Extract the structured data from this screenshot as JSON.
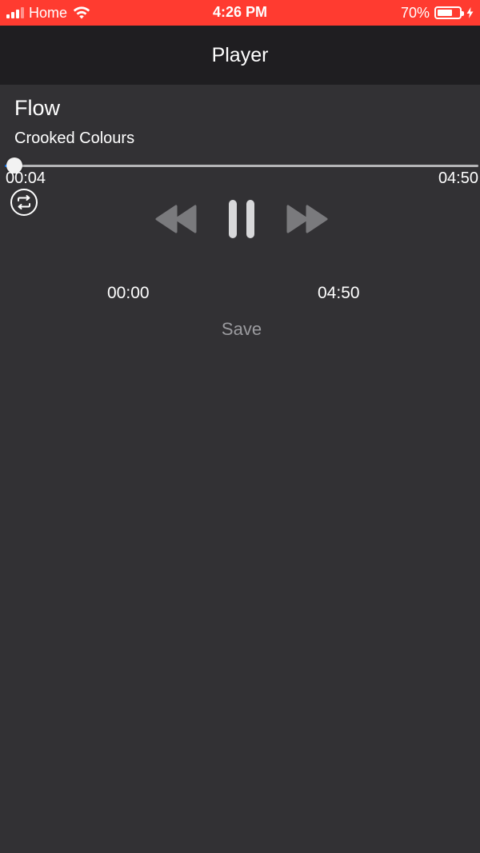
{
  "status_bar": {
    "carrier": "Home",
    "time": "4:26 PM",
    "battery_percent": "70%",
    "battery_level": 0.7,
    "signal_icon": "signal-bars-icon",
    "wifi_icon": "wifi-icon",
    "charging_icon": "bolt-icon",
    "background_color": "#ff3b30"
  },
  "nav": {
    "title": "Player"
  },
  "track": {
    "title": "Flow",
    "artist": "Crooked Colours"
  },
  "playback": {
    "elapsed": "00:04",
    "duration": "04:50",
    "progress_fraction": 0.0138,
    "accent_color": "#0a7aff"
  },
  "controls": {
    "repeat_icon": "repeat-icon",
    "rewind_icon": "rewind-icon",
    "pause_icon": "pause-icon",
    "forward_icon": "fast-forward-icon"
  },
  "range": {
    "start": "00:00",
    "end": "04:50"
  },
  "save": {
    "label": "Save"
  }
}
